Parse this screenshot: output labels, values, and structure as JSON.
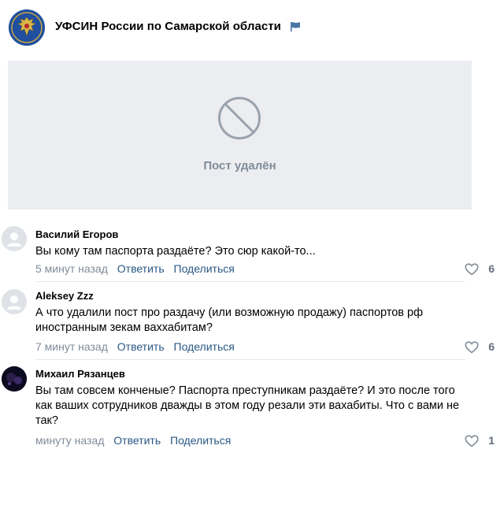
{
  "group": {
    "name": "УФСИН России по Самарской области",
    "logo_icon": "emblem-eagle-icon",
    "flag_icon": "flag-icon",
    "accent_color": "#1f4f9e"
  },
  "post": {
    "deleted_label": "Пост удалён",
    "deleted_icon": "ban-icon"
  },
  "comments": [
    {
      "author": "Василий Егоров",
      "text": "Вы кому там паспорта раздаёте? Это сюр какой-то...",
      "time": "5 минут назад",
      "reply_label": "Ответить",
      "share_label": "Поделиться",
      "likes": "6"
    },
    {
      "author": "Aleksey Zzz",
      "text": "А что удалили пост про раздачу (или возможную продажу) паспортов рф иностранным зекам ваххабитам?",
      "time": "7 минут назад",
      "reply_label": "Ответить",
      "share_label": "Поделиться",
      "likes": "6"
    },
    {
      "author": "Михаил Рязанцев",
      "text": "Вы там совсем конченые? Паспорта преступникам раздаёте? И это после того как ваших сотрудников дважды в этом году резали эти вахабиты. Что с вами не так?",
      "time": "минуту назад",
      "reply_label": "Ответить",
      "share_label": "Поделиться",
      "likes": "1"
    }
  ]
}
